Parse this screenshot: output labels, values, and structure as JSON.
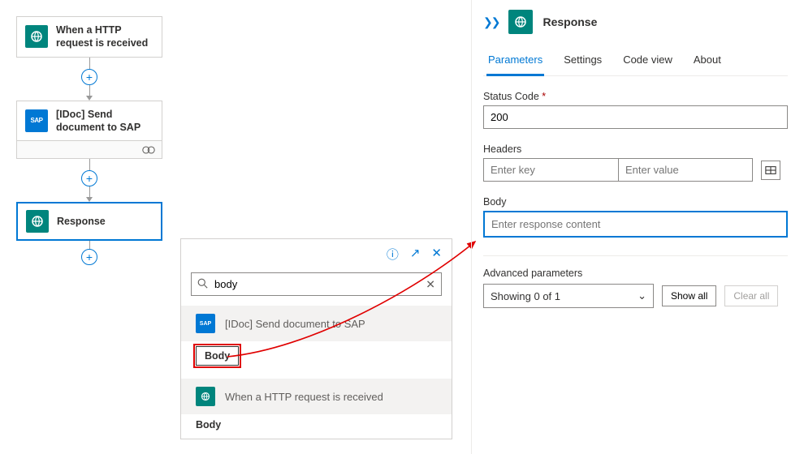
{
  "nodes": {
    "trigger": "When a HTTP request is received",
    "idoc": "[IDoc] Send document to SAP",
    "response": "Response"
  },
  "popup": {
    "search_value": "body",
    "section_idoc": "[IDoc] Send document to SAP",
    "section_trigger": "When a HTTP request is received",
    "body_item": "Body"
  },
  "panel": {
    "title": "Response",
    "tabs": {
      "parameters": "Parameters",
      "settings": "Settings",
      "code": "Code view",
      "about": "About"
    },
    "status_label": "Status Code",
    "status_value": "200",
    "headers_label": "Headers",
    "headers_key_ph": "Enter key",
    "headers_val_ph": "Enter value",
    "body_label": "Body",
    "body_placeholder": "Enter response content",
    "adv_label": "Advanced parameters",
    "adv_select": "Showing 0 of 1",
    "show_all": "Show all",
    "clear_all": "Clear all"
  }
}
